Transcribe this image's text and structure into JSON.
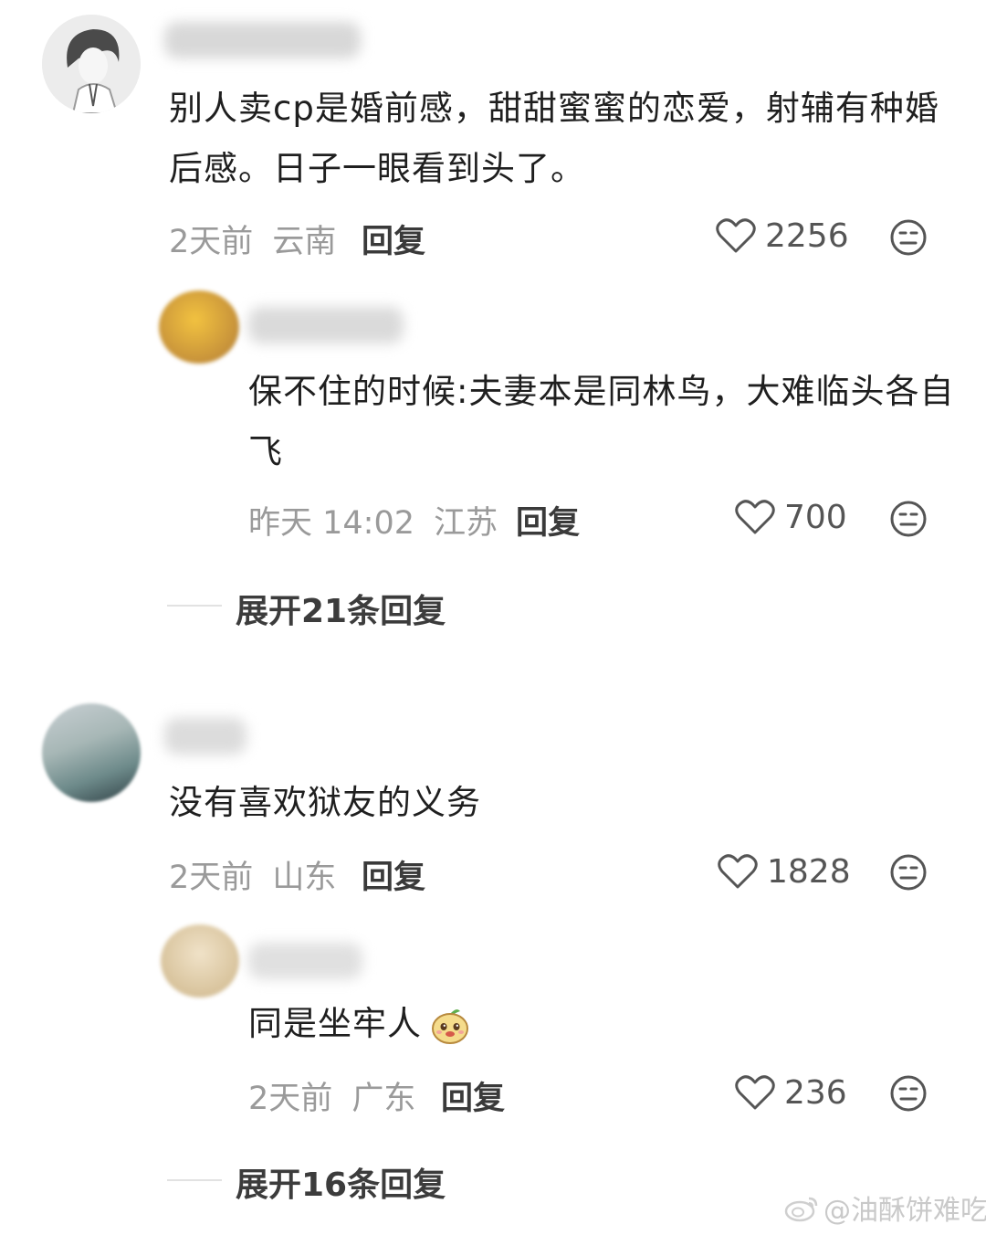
{
  "comments": [
    {
      "text": "别人卖cp是婚前感，甜甜蜜蜜的恋爱，射辅有种婚后感。日子一眼看到头了。",
      "time": "2天前",
      "region": "云南",
      "reply_label": "回复",
      "likes": "2256",
      "sub_reply": {
        "text": "保不住的时候:夫妻本是同林鸟，大难临头各自飞",
        "time": "昨天 14:02",
        "region": "江苏",
        "reply_label": "回复",
        "likes": "700"
      },
      "expand_label": "展开21条回复"
    },
    {
      "text": "没有喜欢狱友的义务",
      "time": "2天前",
      "region": "山东",
      "reply_label": "回复",
      "likes": "1828",
      "sub_reply": {
        "text": "同是坐牢人",
        "emoji": "pear-face-emoji",
        "time": "2天前",
        "region": "广东",
        "reply_label": "回复",
        "likes": "236"
      },
      "expand_label": "展开16条回复"
    }
  ],
  "watermark": "@油酥饼难吃",
  "icons": {
    "like": "heart-outline-icon",
    "dislike": "neutral-face-icon",
    "watermark_logo": "weibo-logo-icon"
  },
  "colors": {
    "background": "#ffffff",
    "primary_text": "#1f1f1f",
    "meta_text": "#9a9a9a",
    "reply_text": "#3a3a3a"
  }
}
